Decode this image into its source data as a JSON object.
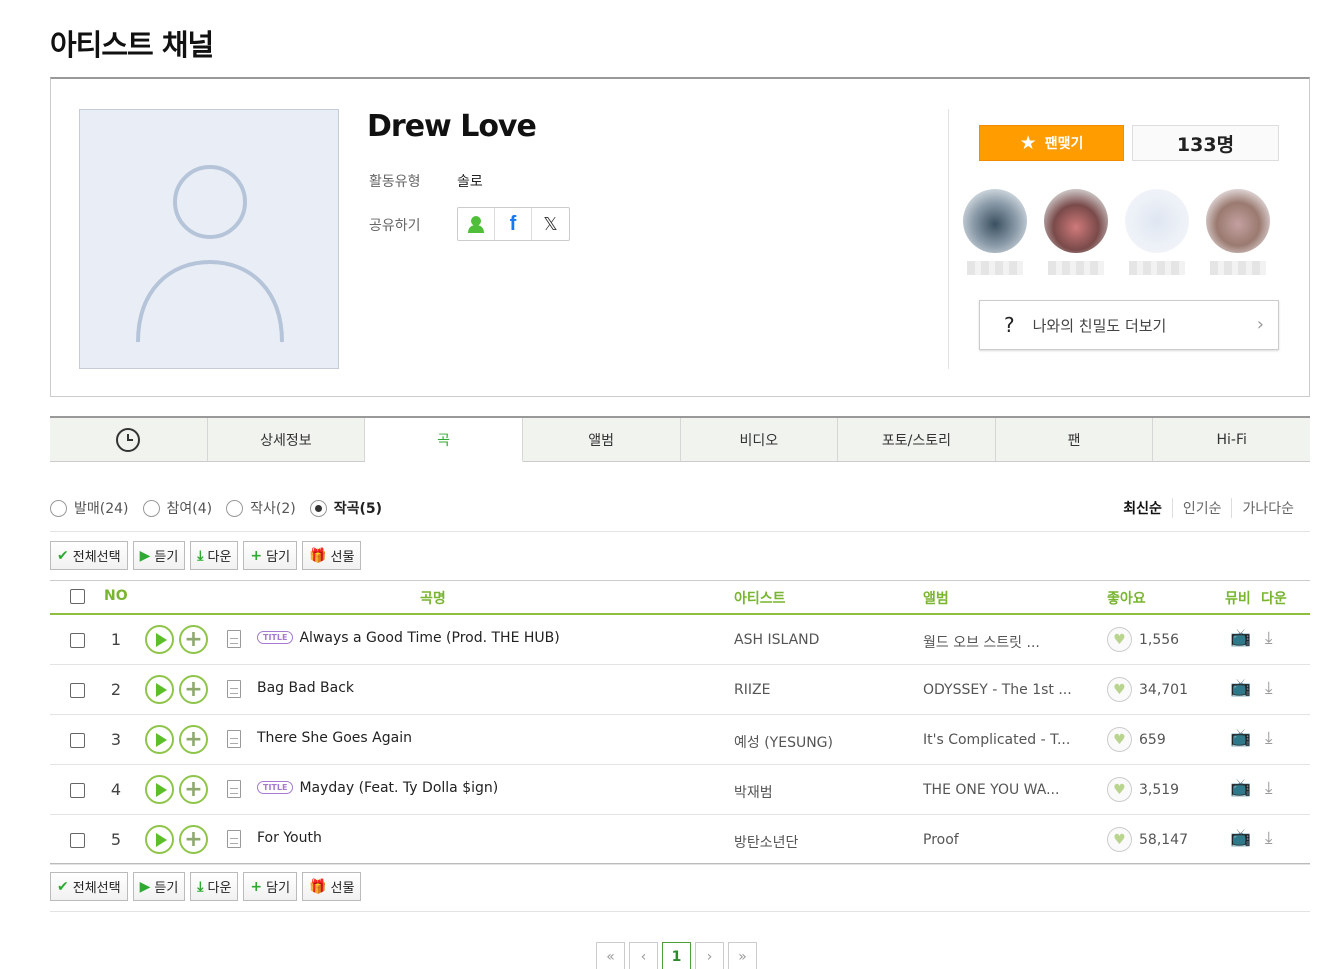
{
  "page": {
    "title": "아티스트 채널"
  },
  "artist": {
    "name": "Drew Love",
    "activity_label": "활동유형",
    "activity_value": "솔로",
    "share_label": "공유하기"
  },
  "fan": {
    "button_label": "팬맺기",
    "count": "133명",
    "closeness_label": "나와의 친밀도 더보기",
    "closeness_prefix": "?"
  },
  "tabs": [
    "상세정보",
    "곡",
    "앨범",
    "비디오",
    "포토/스토리",
    "팬",
    "Hi-Fi"
  ],
  "filters": [
    {
      "label": "발매(24)",
      "selected": false
    },
    {
      "label": "참여(4)",
      "selected": false
    },
    {
      "label": "작사(2)",
      "selected": false
    },
    {
      "label": "작곡(5)",
      "selected": true
    }
  ],
  "sort": [
    "최신순",
    "인기순",
    "가나다순"
  ],
  "actions": {
    "select_all": "전체선택",
    "listen": "듣기",
    "download": "다운",
    "add": "담기",
    "gift": "선물"
  },
  "columns": {
    "no": "NO",
    "song": "곡명",
    "artist": "아티스트",
    "album": "앨범",
    "likes": "좋아요",
    "mv": "뮤비",
    "download": "다운"
  },
  "title_badge": "TITLE",
  "songs": [
    {
      "no": "1",
      "title": "Always a Good Time (Prod. THE HUB)",
      "artist": "ASH ISLAND",
      "album": "월드 오브 스트릿 ...",
      "likes": "1,556"
    },
    {
      "no": "2",
      "title": "Bag Bad Back",
      "artist": "RIIZE",
      "album": "ODYSSEY - The 1st ...",
      "likes": "34,701"
    },
    {
      "no": "3",
      "title": "There She Goes Again",
      "artist": "예성 (YESUNG)",
      "album": "It's Complicated - T...",
      "likes": "659"
    },
    {
      "no": "4",
      "title": "Mayday (Feat. Ty Dolla $ign)",
      "artist": "박재범",
      "album": "THE ONE YOU WA...",
      "likes": "3,519"
    },
    {
      "no": "5",
      "title": "For Youth",
      "artist": "방탄소년단",
      "album": "Proof",
      "likes": "58,147"
    }
  ],
  "pagination": {
    "first": "«",
    "prev": "‹",
    "current": "1",
    "next": "›",
    "last": "»"
  },
  "colors": {
    "accent": "#2eaa32",
    "fan_button": "#ff9c00",
    "header_text": "#7ab532"
  }
}
